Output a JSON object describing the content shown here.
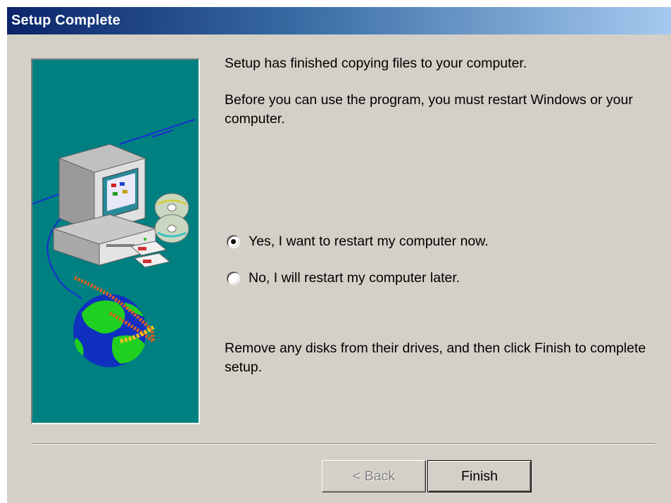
{
  "window": {
    "title": "Setup Complete"
  },
  "content": {
    "line1": "Setup has finished copying files to your computer.",
    "line2": "Before you can use the program, you must restart Windows or your computer.",
    "options": [
      {
        "label": "Yes, I want to restart my computer now.",
        "selected": true
      },
      {
        "label": "No, I will restart my computer later.",
        "selected": false
      }
    ],
    "line3": "Remove any disks from their drives, and then click Finish to complete setup."
  },
  "buttons": {
    "back": "< Back",
    "finish": "Finish"
  },
  "colors": {
    "title_start": "#0a246a",
    "title_end": "#a6caf0",
    "dialog_bg": "#d4d0c8",
    "art_bg": "#008080"
  },
  "icons": [
    "computer-illustration",
    "cd-icon",
    "floppy-icon",
    "globe-icon"
  ]
}
